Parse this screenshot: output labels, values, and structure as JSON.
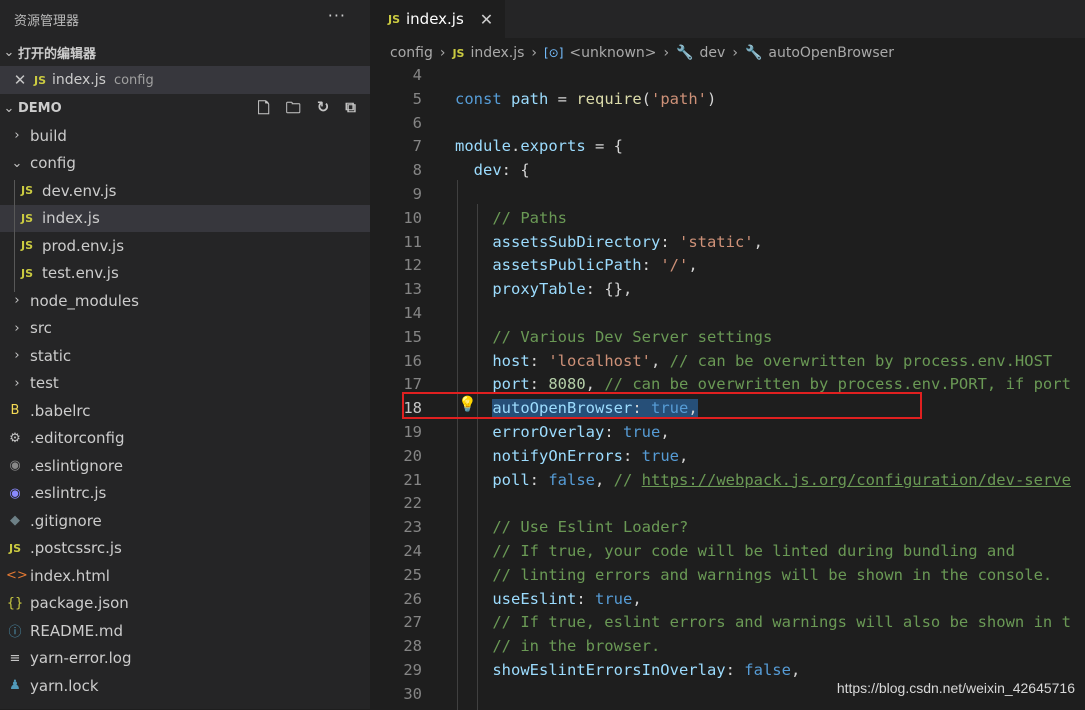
{
  "sidebar": {
    "title": "资源管理器",
    "more": "···",
    "open_editors": {
      "header": "打开的编辑器",
      "items": [
        {
          "icon": "JS",
          "name": "index.js",
          "desc": "config"
        }
      ]
    },
    "workspace": {
      "header": "DEMO",
      "tree": [
        {
          "kind": "folder",
          "name": "build",
          "expanded": false
        },
        {
          "kind": "folder",
          "name": "config",
          "expanded": true
        },
        {
          "kind": "file",
          "icon": "JS",
          "name": "dev.env.js"
        },
        {
          "kind": "file",
          "icon": "JS",
          "name": "index.js",
          "selected": true
        },
        {
          "kind": "file",
          "icon": "JS",
          "name": "prod.env.js"
        },
        {
          "kind": "file",
          "icon": "JS",
          "name": "test.env.js"
        },
        {
          "kind": "folder",
          "name": "node_modules"
        },
        {
          "kind": "folder",
          "name": "src"
        },
        {
          "kind": "folder",
          "name": "static"
        },
        {
          "kind": "folder",
          "name": "test"
        },
        {
          "kind": "file",
          "icon": "B",
          "name": ".babelrc"
        },
        {
          "kind": "file",
          "icon": "⚙",
          "name": ".editorconfig"
        },
        {
          "kind": "file",
          "icon": "◉",
          "name": ".eslintignore"
        },
        {
          "kind": "file",
          "icon": "◉",
          "name": ".eslintrc.js"
        },
        {
          "kind": "file",
          "icon": "◆",
          "name": ".gitignore"
        },
        {
          "kind": "file",
          "icon": "JS",
          "name": ".postcssrc.js"
        },
        {
          "kind": "file",
          "icon": "<>",
          "name": "index.html"
        },
        {
          "kind": "file",
          "icon": "{}",
          "name": "package.json"
        },
        {
          "kind": "file",
          "icon": "ⓘ",
          "name": "README.md"
        },
        {
          "kind": "file",
          "icon": "≡",
          "name": "yarn-error.log"
        },
        {
          "kind": "file",
          "icon": "♟",
          "name": "yarn.lock"
        }
      ]
    }
  },
  "editor": {
    "tab": {
      "icon": "JS",
      "label": "index.js",
      "close": "✕"
    },
    "breadcrumb": {
      "config": "config",
      "file": "index.js",
      "unknown": "<unknown>",
      "dev": "dev",
      "prop": "autoOpenBrowser"
    },
    "lines": [
      {
        "n": "4",
        "html": ""
      },
      {
        "n": "5",
        "html": "<span class=\"kw\">const</span> <span class=\"var\">path</span> = <span class=\"fn\">require</span>(<span class=\"str\">'path'</span>)"
      },
      {
        "n": "6",
        "html": ""
      },
      {
        "n": "7",
        "html": "<span class=\"var\">module</span>.<span class=\"var\">exports</span> = {"
      },
      {
        "n": "8",
        "html": "  <span class=\"var\">dev</span>: {"
      },
      {
        "n": "9",
        "html": ""
      },
      {
        "n": "10",
        "html": "    <span class=\"cm\">// Paths</span>"
      },
      {
        "n": "11",
        "html": "    <span class=\"var\">assetsSubDirectory</span>: <span class=\"str\">'static'</span>,"
      },
      {
        "n": "12",
        "html": "    <span class=\"var\">assetsPublicPath</span>: <span class=\"str\">'/'</span>,"
      },
      {
        "n": "13",
        "html": "    <span class=\"var\">proxyTable</span>: {},"
      },
      {
        "n": "14",
        "html": ""
      },
      {
        "n": "15",
        "html": "    <span class=\"cm\">// Various Dev Server settings</span>"
      },
      {
        "n": "16",
        "html": "    <span class=\"var\">host</span>: <span class=\"str\">'localhost'</span>, <span class=\"cm\">// can be overwritten by process.env.HOST</span>"
      },
      {
        "n": "17",
        "html": "    <span class=\"var\">port</span>: <span class=\"num\">8080</span>, <span class=\"cm\">// can be overwritten by process.env.PORT, if port</span>"
      },
      {
        "n": "18",
        "html": "    <span class=\"sel\"><span class=\"var\">autoOpenBrowser</span>: <span class=\"kw\">true</span>,</span>",
        "active": true
      },
      {
        "n": "19",
        "html": "    <span class=\"var\">errorOverlay</span>: <span class=\"kw\">true</span>,"
      },
      {
        "n": "20",
        "html": "    <span class=\"var\">notifyOnErrors</span>: <span class=\"kw\">true</span>,"
      },
      {
        "n": "21",
        "html": "    <span class=\"var\">poll</span>: <span class=\"kw\">false</span>, <span class=\"cm\">// </span><span class=\"link\">https://webpack.js.org/configuration/dev-serve</span>"
      },
      {
        "n": "22",
        "html": ""
      },
      {
        "n": "23",
        "html": "    <span class=\"cm\">// Use Eslint Loader?</span>"
      },
      {
        "n": "24",
        "html": "    <span class=\"cm\">// If true, your code will be linted during bundling and</span>"
      },
      {
        "n": "25",
        "html": "    <span class=\"cm\">// linting errors and warnings will be shown in the console.</span>"
      },
      {
        "n": "26",
        "html": "    <span class=\"var\">useEslint</span>: <span class=\"kw\">true</span>,"
      },
      {
        "n": "27",
        "html": "    <span class=\"cm\">// If true, eslint errors and warnings will also be shown in t</span>"
      },
      {
        "n": "28",
        "html": "    <span class=\"cm\">// in the browser.</span>"
      },
      {
        "n": "29",
        "html": "    <span class=\"var\">showEslintErrorsInOverlay</span>: <span class=\"kw\">false</span>,"
      },
      {
        "n": "30",
        "html": ""
      }
    ]
  },
  "watermark": "https://blog.csdn.net/weixin_42645716"
}
